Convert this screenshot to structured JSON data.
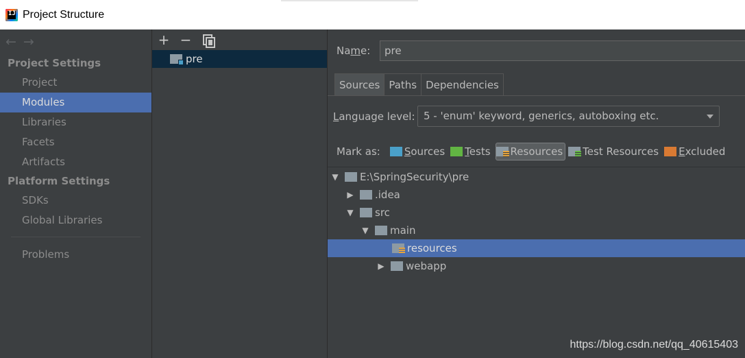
{
  "window": {
    "title": "Project Structure"
  },
  "nav": {
    "back": "←",
    "forward": "→",
    "sections": [
      {
        "label": "Project Settings",
        "items": [
          "Project",
          "Modules",
          "Libraries",
          "Facets",
          "Artifacts"
        ]
      },
      {
        "label": "Platform Settings",
        "items": [
          "SDKs",
          "Global Libraries"
        ]
      }
    ],
    "selected": "Modules",
    "problems": "Problems"
  },
  "module_list": {
    "toolbar": {
      "add": "+",
      "remove": "−"
    },
    "modules": [
      "pre"
    ]
  },
  "detail": {
    "name_label": "Name:",
    "name_value": "pre",
    "tabs": [
      "Sources",
      "Paths",
      "Dependencies"
    ],
    "active_tab": "Sources",
    "language_label": "Language level:",
    "language_value": "5 - 'enum' keyword, generics, autoboxing etc.",
    "mark_as_label": "Mark as:",
    "mark_buttons": [
      "Sources",
      "Tests",
      "Resources",
      "Test Resources",
      "Excluded"
    ],
    "pressed_mark": "Resources"
  },
  "tree": {
    "root": "E:\\SpringSecurity\\pre",
    "nodes": [
      ".idea",
      "src",
      "main",
      "resources",
      "webapp"
    ],
    "selected": "resources"
  },
  "watermark": "https://blog.csdn.net/qq_40615403"
}
